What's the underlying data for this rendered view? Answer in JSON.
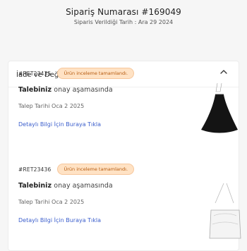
{
  "order": {
    "number": "Sipariş Numarası #169049",
    "date": "Siparis Verildiği Tarih : Ara 29 2024"
  },
  "section": {
    "title": "İade ve Değişim Geçmişi"
  },
  "items": [
    {
      "code": "#RET23435",
      "status": "Ürün inceleme tamamlandı.",
      "title_bold": "Talebiniz",
      "title_rest": "onay aşamasında",
      "request_date": "Talep Tarihi Oca 2 2025",
      "details_link": "Detaylı Bilgi İçin Buraya Tıkla"
    },
    {
      "code": "#RET23436",
      "status": "Ürün inceleme tamamlandı.",
      "title_bold": "Talebiniz",
      "title_rest": "onay aşamasında",
      "request_date": "Talep Tarihi Oca 2 2025",
      "details_link": "Detaylı Bilgi İçin Buraya Tıkla"
    }
  ],
  "colors": {
    "badge_bg": "#ffe2c4",
    "badge_text": "#b55a0e",
    "link": "#3b5ecc"
  },
  "icons": {
    "collapse": "chevron-up-icon",
    "product_1": "black-dress-image",
    "product_2": "white-top-image"
  }
}
